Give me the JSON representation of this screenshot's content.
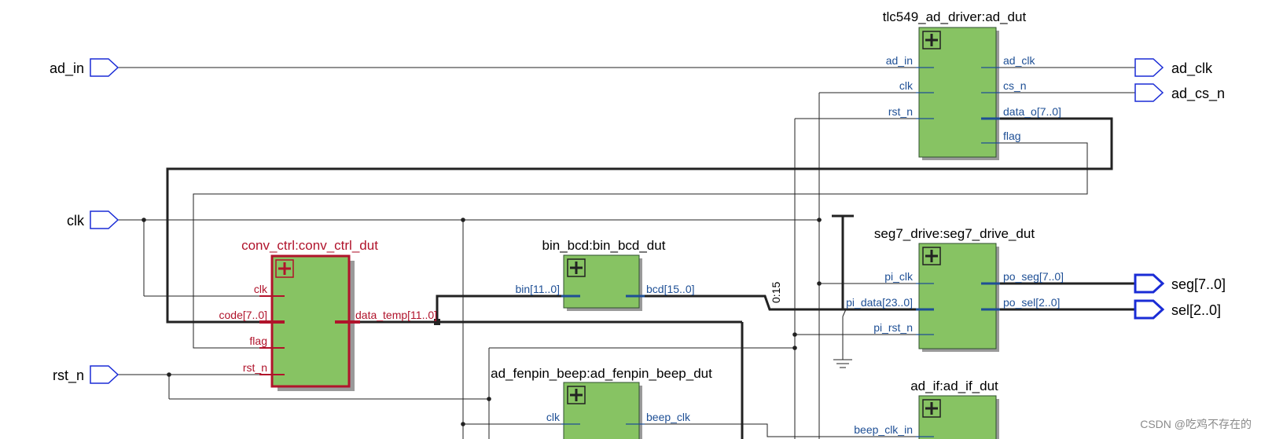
{
  "diagram": {
    "ports": {
      "ad_in": "ad_in",
      "clk": "clk",
      "rst_n": "rst_n",
      "ad_clk": "ad_clk",
      "ad_cs_n": "ad_cs_n",
      "seg": "seg[7..0]",
      "sel": "sel[2..0]"
    },
    "blocks": {
      "tlc549": {
        "title": "tlc549_ad_driver:ad_dut",
        "inputs": [
          "ad_in",
          "clk",
          "rst_n"
        ],
        "outputs": [
          "ad_clk",
          "cs_n",
          "data_o[7..0]",
          "flag"
        ]
      },
      "conv_ctrl": {
        "title": "conv_ctrl:conv_ctrl_dut",
        "inputs": [
          "clk",
          "code[7..0]",
          "flag",
          "rst_n"
        ],
        "outputs": [
          "data_temp[11..0]"
        ]
      },
      "bin_bcd": {
        "title": "bin_bcd:bin_bcd_dut",
        "inputs": [
          "bin[11..0]"
        ],
        "outputs": [
          "bcd[15..0]"
        ]
      },
      "seg7": {
        "title": "seg7_drive:seg7_drive_dut",
        "inputs": [
          "pi_clk",
          "pi_data[23..0]",
          "pi_rst_n"
        ],
        "outputs": [
          "po_seg[7..0]",
          "po_sel[2..0]"
        ]
      },
      "fenpin": {
        "title": "ad_fenpin_beep:ad_fenpin_beep_dut",
        "inputs": [
          "clk"
        ],
        "outputs": [
          "beep_clk"
        ]
      },
      "ad_if": {
        "title": "ad_if:ad_if_dut",
        "inputs": [
          "beep_clk_in"
        ]
      }
    },
    "bus_slice": "0:15",
    "watermark": "CSDN @吃鸡不存在的"
  }
}
